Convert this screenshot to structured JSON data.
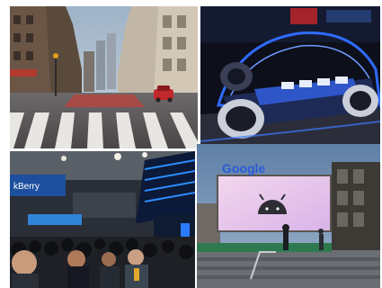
{
  "collage": {
    "street": {
      "description_shown": ""
    },
    "exhibit": {
      "description_shown": ""
    },
    "expo_floor": {
      "sign_text": "kBerry"
    },
    "billboard": {
      "logo_text": "Google"
    }
  }
}
